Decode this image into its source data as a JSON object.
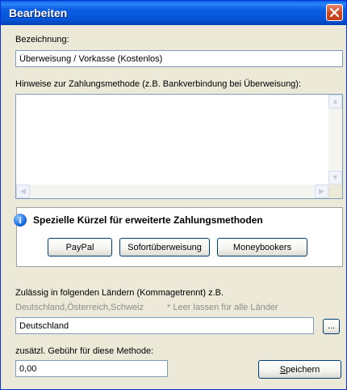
{
  "window": {
    "title": "Bearbeiten"
  },
  "bezeichnung": {
    "label": "Bezeichnung:",
    "value": "Überweisung / Vorkasse (Kostenlos)"
  },
  "hinweise": {
    "label": "Hinweise zur Zahlungsmethode (z.B. Bankverbindung bei Überweisung):",
    "value": ""
  },
  "kuerzel": {
    "title": "Spezielle Kürzel für erweiterte Zahlungsmethoden",
    "buttons": [
      "PayPal",
      "Sofortüberweisung",
      "Moneybookers"
    ]
  },
  "laender": {
    "label": "Zulässig in folgenden Ländern (Kommagetrennt) z.B.",
    "example": "Deutschland,Österreich,Schweiz",
    "note": "* Leer lassen für alle Länder",
    "value": "Deutschland",
    "browse_label": "..."
  },
  "gebuehr": {
    "label": "zusätzl. Gebühr für diese Methode:",
    "value": "0,00"
  },
  "save": {
    "mnemonic": "S",
    "rest": "peichern"
  }
}
